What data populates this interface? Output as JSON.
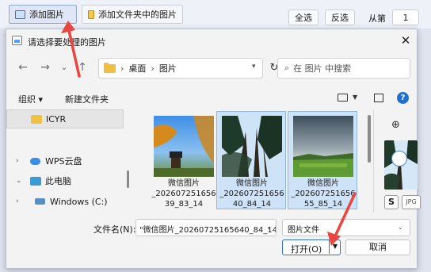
{
  "app_toolbar": {
    "add_image_label": "添加图片",
    "add_folder_label": "添加文件夹中的图片",
    "select_all_label": "全选",
    "invert_label": "反选",
    "from_label": "从第",
    "page_value": "1"
  },
  "dialog": {
    "title": "请选择要处理的图片",
    "close_glyph": "✕",
    "nav": {
      "back_glyph": "←",
      "forward_glyph": "→",
      "dropdown_glyph": "⌄",
      "up_glyph": "↑",
      "breadcrumb": [
        "桌面",
        "图片"
      ],
      "refresh_glyph": "↻",
      "search_placeholder": "在 图片 中搜索"
    },
    "commands": {
      "organize_label": "组织 ▾",
      "new_folder_label": "新建文件夹"
    },
    "sidebar": [
      {
        "label": "ICYR",
        "icon": "folder-icon",
        "selected": true
      },
      {
        "label": "WPS云盘",
        "icon": "cloud-icon",
        "selected": false
      },
      {
        "label": "此电脑",
        "icon": "computer-icon",
        "selected": false
      },
      {
        "label": "Windows (C:)",
        "icon": "drive-icon",
        "selected": false
      }
    ],
    "files": [
      {
        "name": "微信图片\n_202607251656\n39_83_14",
        "selected": false
      },
      {
        "name": "微信图片\n_202607251656\n40_84_14",
        "selected": true
      },
      {
        "name": "微信图片\n_202607251656\n55_85_14",
        "selected": true
      }
    ],
    "preview": {
      "s_badge": "S",
      "jpg_badge": "JPG"
    },
    "filename_label": "文件名(N):",
    "filename_value": "\"微信图片_20260725165640_84_14",
    "filetype_value": "图片文件",
    "open_label": "打开(O)",
    "cancel_label": "取消"
  },
  "colors": {
    "accent": "#2c6fc9",
    "selection": "#cfe3f8",
    "annotation": "#e8463f"
  }
}
